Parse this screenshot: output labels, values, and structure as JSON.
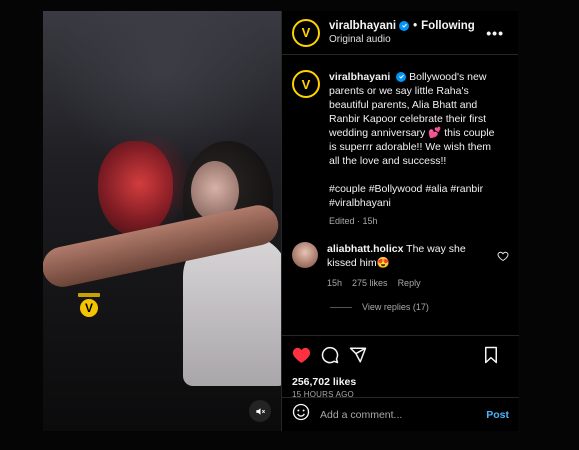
{
  "header": {
    "username": "viralbhayani",
    "follow_status": "Following",
    "separator": "•",
    "subtitle": "Original audio",
    "more_label": "•••",
    "avatar_letter": "V"
  },
  "media": {
    "watermark_letter": "V"
  },
  "caption": {
    "username": "viralbhayani",
    "text": "Bollywood's new parents or we say little Raha's beautiful parents, Alia Bhatt and Ranbir Kapoor celebrate their first wedding anniversary 💕 this couple is superrr adorable!! We wish them all the love and success!!",
    "hashtags": "#couple #Bollywood #alia #ranbir #viralbhayani",
    "edited": "Edited · 15h"
  },
  "comment": {
    "username": "aliabhatt.holicx",
    "text": "The way she kissed him😍",
    "time": "15h",
    "likes": "275 likes",
    "reply_label": "Reply",
    "view_replies": "View replies (17)"
  },
  "actions": {
    "likes": "256,702 likes",
    "time_ago": "15 HOURS AGO"
  },
  "comment_box": {
    "placeholder": "Add a comment...",
    "post_label": "Post"
  },
  "colors": {
    "accent": "#0095f6",
    "like_red": "#ff3040",
    "brand_yellow": "#ffd200",
    "post_blue": "#4cb5f9"
  },
  "icons": [
    "verified-badge-icon",
    "more-options-icon",
    "heart-icon",
    "comment-icon",
    "share-icon",
    "bookmark-icon",
    "emoji-icon",
    "mute-icon",
    "small-heart-icon"
  ]
}
